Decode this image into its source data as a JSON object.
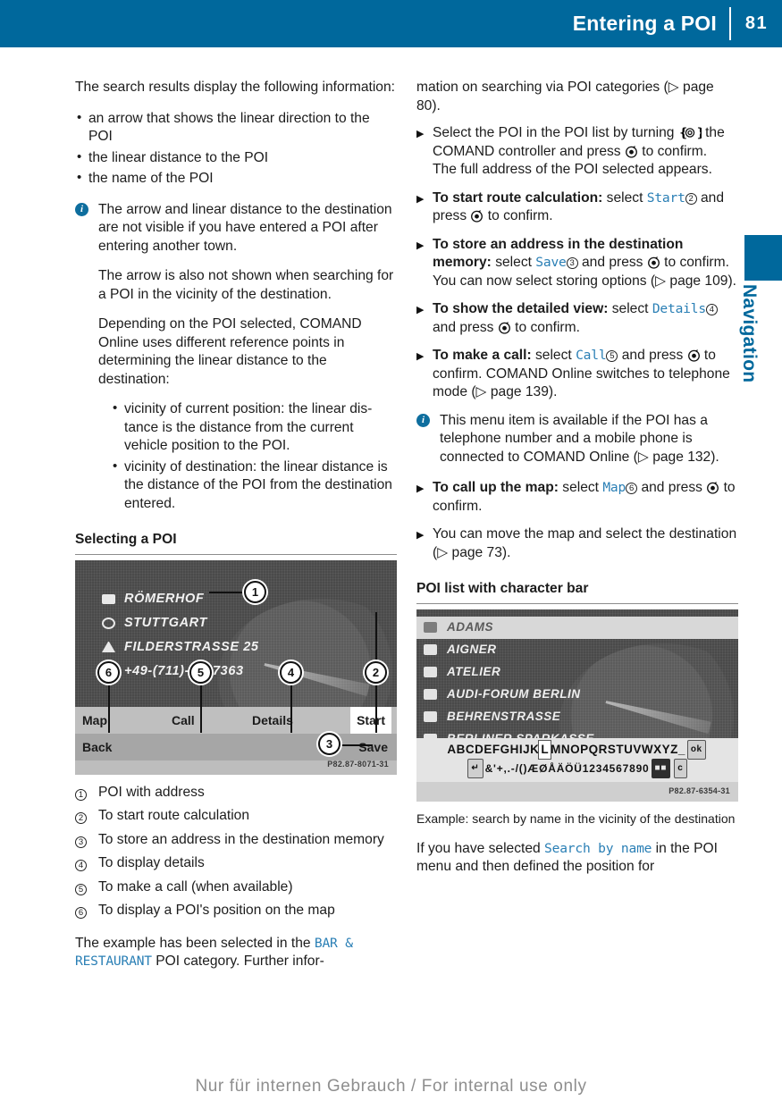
{
  "header": {
    "title": "Entering a POI",
    "page_number": "81"
  },
  "side_tab": {
    "label": "Navigation"
  },
  "left_column": {
    "intro": "The search results display the following infor­mation:",
    "bullets": [
      "an arrow that shows the linear direction to the POI",
      "the linear distance to the POI",
      "the name of the POI"
    ],
    "note": {
      "paragraphs": [
        "The arrow and linear distance to the des­tination are not visible if you have entered a POI after entering another town.",
        "The arrow is also not shown when search­ing for a POI in the vicinity of the destina­tion.",
        "Depending on the POI selected, COMAND Online uses different reference points in determining the linear distance to the destination:"
      ],
      "sub_bullets": [
        "vicinity of current position: the linear dis­tance is the distance from the current vehicle position to the POI.",
        "vicinity of destination: the linear distance is the distance of the POI from the des­tination entered."
      ]
    },
    "section_heading": "Selecting a POI",
    "figure": {
      "image_id": "P82.87-8071-31",
      "poi_name": "RÖMERHOF",
      "poi_city": "STUTTGART",
      "poi_street": "FILDERSTRASSE 25",
      "poi_phone": "+49-(711)-6407363",
      "menu": [
        "Map",
        "Call",
        "Details",
        "Start"
      ],
      "menu2": [
        "Back",
        "Save"
      ],
      "callouts": [
        "1",
        "2",
        "3",
        "4",
        "5",
        "6"
      ]
    },
    "legend": [
      {
        "num": "1",
        "text": "POI with address"
      },
      {
        "num": "2",
        "text": "To start route calculation"
      },
      {
        "num": "3",
        "text": "To store an address in the destination memory"
      },
      {
        "num": "4",
        "text": "To display details"
      },
      {
        "num": "5",
        "text": "To make a call (when available)"
      },
      {
        "num": "6",
        "text": "To display a POI's position on the map"
      }
    ],
    "closing_pre": "The example has been selected in the ",
    "closing_term": "BAR & RESTAURANT",
    "closing_post": " POI category. Further infor-"
  },
  "right_column": {
    "cont_text": "mation on searching via POI categories (▷ page 80).",
    "steps": [
      {
        "bold": "",
        "text_1": "Select the POI in the POI list by turning ",
        "icon_1": "comand-controller-rotate-icon",
        "text_2": " the COMAND controller and press ",
        "icon_2": "comand-controller-press-icon",
        "text_3": " to confirm.",
        "extra": "The full address of the POI selected appears."
      },
      {
        "bold": "To start route calculation:",
        "text_1": " select ",
        "ui_term": "Start",
        "cnum": "2",
        "text_2": " and press ",
        "icon_2": "comand-controller-press-icon",
        "text_3": " to confirm."
      },
      {
        "bold": "To store an address in the destination memory:",
        "text_1": " select ",
        "ui_term": "Save",
        "cnum": "3",
        "text_2": " and press ",
        "icon_2": "comand-controller-press-icon",
        "text_3": " to confirm. You can now select storing options (▷ page 109)."
      },
      {
        "bold": "To show the detailed view:",
        "text_1": " select ",
        "ui_term": "Details",
        "cnum": "4",
        "text_2": " and press ",
        "icon_2": "comand-controller-press-icon",
        "text_3": " to confirm."
      },
      {
        "bold": "To make a call:",
        "text_1": " select ",
        "ui_term": "Call",
        "cnum": "5",
        "text_2": " and press ",
        "icon_2": "comand-controller-press-icon",
        "text_3": " to confirm. COMAND Online switches to telephone mode (▷ page 139)."
      }
    ],
    "note": "This menu item is available if the POI has a telephone number and a mobile phone is connected to COMAND Online (▷ page 132).",
    "steps_2": [
      {
        "bold": "To call up the map:",
        "text_1": " select ",
        "ui_term": "Map",
        "cnum": "6",
        "text_2": " and press ",
        "icon_2": "comand-controller-press-icon",
        "text_3": " to confirm."
      }
    ],
    "step_move_map": "You can move the map and select the des­tination (▷ page 73).",
    "section_heading": "POI list with character bar",
    "figure": {
      "image_id": "P82.87-6354-31",
      "list_items": [
        "ADAMS",
        "AIGNER",
        "ATELIER",
        "AUDI-FORUM BERLIN",
        "BEHRENSTRASSE",
        "BERLINER SPARKASSE"
      ],
      "selected_item": "ADAMS",
      "char_row_1": "ABCDEFGHIJKLMNOPQRSTUVWXYZ_",
      "char_selected": "L",
      "ok_key": "ok",
      "char_row_2": "&'+,.-/()ÆØÅÄÖÜ1234567890",
      "back_key": "↵",
      "clear_key": "c"
    },
    "figure_caption": "Example: search by name in the vicinity of the des­tination",
    "closing_pre": "If you have selected ",
    "closing_term": "Search by name",
    "closing_post": " in the POI menu and then defined the position for"
  },
  "footer": {
    "text": "Nur für internen Gebrauch / For internal use only"
  },
  "colors": {
    "brand_blue": "#00689c",
    "ui_term_blue": "#2a7fb5"
  }
}
